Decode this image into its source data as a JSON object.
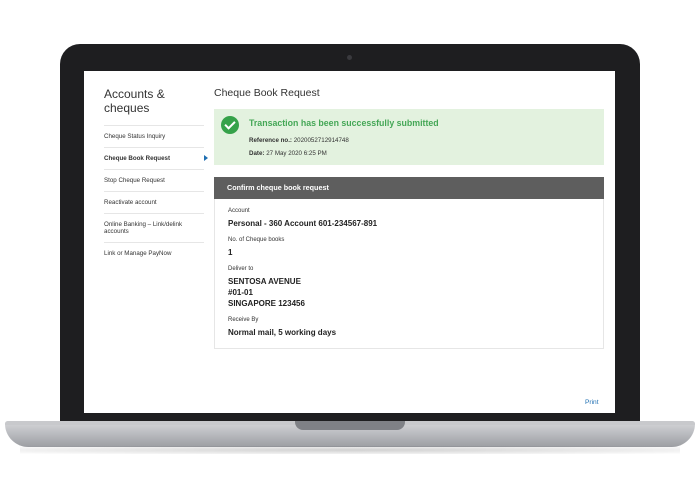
{
  "sidebar": {
    "title": "Accounts & cheques",
    "items": [
      {
        "label": "Cheque Status Inquiry"
      },
      {
        "label": "Cheque Book Request"
      },
      {
        "label": "Stop Cheque Request"
      },
      {
        "label": "Reactivate account"
      },
      {
        "label": "Online Banking – Link/delink accounts"
      },
      {
        "label": "Link or Manage PayNow"
      }
    ]
  },
  "main": {
    "title": "Cheque Book Request",
    "success": {
      "message": "Transaction has been successfully submitted",
      "reference_label": "Reference no.:",
      "reference_value": "2020052712914748",
      "date_label": "Date:",
      "date_value": "27 May 2020 6:25 PM"
    },
    "confirm_header": "Confirm cheque book request",
    "fields": {
      "account_label": "Account",
      "account_value": "Personal - 360 Account 601-234567-891",
      "books_label": "No. of Cheque books",
      "books_value": "1",
      "deliver_label": "Deliver to",
      "deliver_line1": "SENTOSA AVENUE",
      "deliver_line2": "#01-01",
      "deliver_line3": "SINGAPORE 123456",
      "receive_label": "Receive By",
      "receive_value": "Normal mail, 5 working days"
    },
    "print_label": "Print"
  },
  "icons": {
    "success": "check-circle-icon",
    "active_marker": "triangle-right-icon"
  },
  "colors": {
    "success_green": "#44a756",
    "success_bg": "#e3f2df",
    "header_bar": "#5e5e5e",
    "link_blue": "#1f6fb2"
  }
}
